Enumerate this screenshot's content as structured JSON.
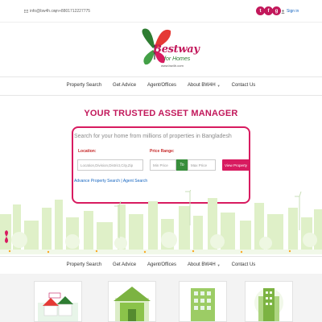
{
  "topbar": {
    "email": "info@bw4h.com",
    "phone": "+8801712227775",
    "social": [
      {
        "icon": "twitter-icon",
        "glyph": "t"
      },
      {
        "icon": "facebook-icon",
        "glyph": "f"
      },
      {
        "icon": "google-plus-icon",
        "glyph": "g"
      }
    ],
    "signin_label": "Sign in"
  },
  "logo": {
    "brand": "Bestway",
    "tagline": "for Homes",
    "url": "www.bw4h.com"
  },
  "nav": {
    "items": [
      {
        "label": "Property Search",
        "dropdown": false
      },
      {
        "label": "Get Advice",
        "dropdown": false
      },
      {
        "label": "Agent/Offices",
        "dropdown": false
      },
      {
        "label": "About BW4H",
        "dropdown": true
      },
      {
        "label": "Contact Us",
        "dropdown": false
      }
    ]
  },
  "hero": {
    "headline": "YOUR TRUSTED ASSET MANAGER",
    "search_title": "Search for your home from millions of properties in Bangladesh",
    "location_label": "Location:",
    "location_placeholder": "Location,Division,District,City,Zip",
    "price_label": "Price Range:",
    "min_placeholder": "Min Price",
    "to_label": "To",
    "max_placeholder": "Max Price",
    "view_button": "View Property",
    "advanced_link": "Advance Property Search",
    "link_separator": "|",
    "agent_link": "Agent Search"
  },
  "colors": {
    "brand": "#c2185b",
    "accent_green": "#388e3c",
    "link": "#1565c0"
  }
}
